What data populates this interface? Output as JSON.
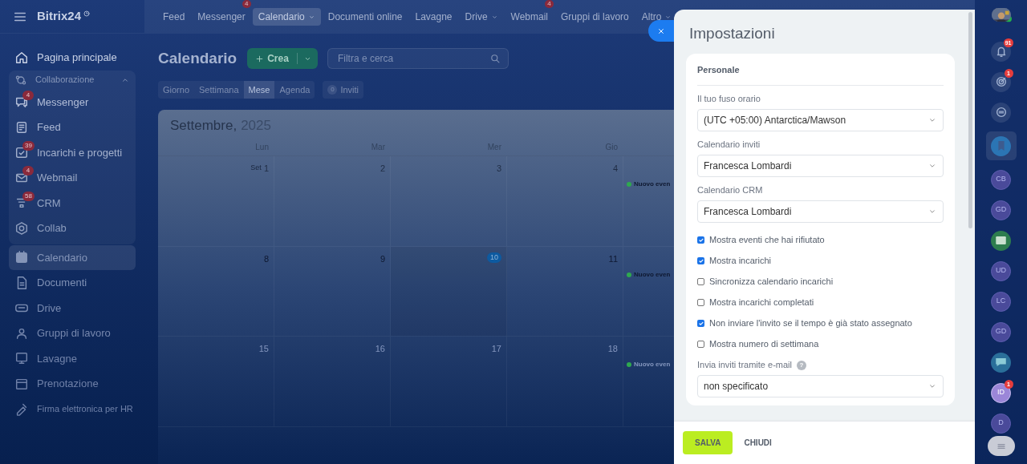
{
  "header": {
    "logo": "Bitrix24"
  },
  "top_nav": [
    {
      "label": "Feed",
      "selected": false,
      "dropdown": false
    },
    {
      "label": "Messenger",
      "selected": false,
      "dropdown": false,
      "badge": "4"
    },
    {
      "label": "Calendario",
      "selected": true,
      "dropdown": true
    },
    {
      "label": "Documenti online",
      "selected": false,
      "dropdown": false
    },
    {
      "label": "Lavagne",
      "selected": false,
      "dropdown": false
    },
    {
      "label": "Drive",
      "selected": false,
      "dropdown": true
    },
    {
      "label": "Webmail",
      "selected": false,
      "dropdown": false,
      "badge": "4"
    },
    {
      "label": "Gruppi di lavoro",
      "selected": false,
      "dropdown": false
    },
    {
      "label": "Altro",
      "selected": false,
      "dropdown": true
    }
  ],
  "sidebar": {
    "items": [
      {
        "kind": "home",
        "label": "Pagina principale",
        "selected": false
      },
      {
        "kind": "group",
        "label": "Collaborazione",
        "expanded": true,
        "children": [
          {
            "kind": "chat",
            "label": "Messenger",
            "selected": false,
            "badge": "4"
          },
          {
            "kind": "feed",
            "label": "Feed",
            "selected": false
          },
          {
            "kind": "tasks",
            "label": "Incarichi e progetti",
            "selected": false,
            "badge": "39"
          },
          {
            "kind": "mail",
            "label": "Webmail",
            "selected": false,
            "badge": "4"
          },
          {
            "kind": "crm",
            "label": "CRM",
            "selected": false,
            "badge": "58"
          },
          {
            "kind": "collab",
            "label": "Collab",
            "selected": false
          }
        ]
      },
      {
        "kind": "calendar",
        "label": "Calendario",
        "selected": true
      },
      {
        "kind": "doc",
        "label": "Documenti",
        "selected": false
      },
      {
        "kind": "drive",
        "label": "Drive",
        "selected": false
      },
      {
        "kind": "groups",
        "label": "Gruppi di lavoro",
        "selected": false
      },
      {
        "kind": "board",
        "label": "Lavagne",
        "selected": false
      },
      {
        "kind": "booking",
        "label": "Prenotazione",
        "selected": false
      },
      {
        "kind": "sign",
        "label": "Firma elettronica per HR",
        "selected": false
      }
    ]
  },
  "toolbar": {
    "title": "Calendario",
    "create_button": "Crea",
    "search": {
      "placeholder": "Filtra e cerca"
    },
    "views": [
      {
        "label": "Giorno",
        "selected": false
      },
      {
        "label": "Settimana",
        "selected": false
      },
      {
        "label": "Mese",
        "selected": true
      },
      {
        "label": "Agenda",
        "selected": false
      }
    ],
    "invites": {
      "count": "0",
      "label": "Inviti"
    }
  },
  "calendar": {
    "month": "Settembre,",
    "year": "2025",
    "weekdays": [
      "Lun",
      "Mar",
      "Mer",
      "Gio"
    ],
    "weeks": [
      {
        "days": [
          {
            "prefix": "Set",
            "label": "1",
            "today": false
          },
          {
            "label": "2",
            "today": false
          },
          {
            "label": "3",
            "today": false
          },
          {
            "label": "4",
            "today": false
          }
        ],
        "event": {
          "title": "Nuovo even",
          "color": "#2fa84f"
        }
      },
      {
        "days": [
          {
            "label": "8",
            "today": false
          },
          {
            "label": "9",
            "today": false
          },
          {
            "label": "10",
            "today": true
          },
          {
            "label": "11",
            "today": false
          }
        ],
        "event": {
          "title": "Nuovo even",
          "color": "#2fa84f"
        }
      },
      {
        "days": [
          {
            "label": "15",
            "today": false
          },
          {
            "label": "16",
            "today": false
          },
          {
            "label": "17",
            "today": false
          },
          {
            "label": "18",
            "today": false
          }
        ],
        "event": {
          "title": "Nuovo even",
          "color": "#2fa84f"
        }
      }
    ]
  },
  "settings": {
    "title": "Impostazioni",
    "section": "Personale",
    "items": [
      {
        "kind": "select",
        "label": "Il tuo fuso orario",
        "value": "(UTC +05:00) Antarctica/Mawson"
      },
      {
        "kind": "select",
        "label": "Calendario inviti",
        "value": "Francesca Lombardi"
      },
      {
        "kind": "select",
        "label": "Calendario CRM",
        "value": "Francesca Lombardi"
      },
      {
        "kind": "checkbox",
        "label": "Mostra eventi che hai rifiutato",
        "checked": true
      },
      {
        "kind": "checkbox",
        "label": "Mostra incarichi",
        "checked": true
      },
      {
        "kind": "checkbox",
        "label": "Sincronizza calendario incarichi",
        "checked": false
      },
      {
        "kind": "checkbox",
        "label": "Mostra incarichi completati",
        "checked": false
      },
      {
        "kind": "checkbox",
        "label": "Non inviare l'invito se il tempo è già stato assegnato",
        "checked": true
      },
      {
        "kind": "checkbox",
        "label": "Mostra numero di settimana",
        "checked": false
      },
      {
        "kind": "select",
        "label": "Invia inviti tramite e-mail",
        "value": "non specificato",
        "help": "?"
      }
    ],
    "buttons": [
      {
        "kind": "primary",
        "label": "SALVA"
      },
      {
        "kind": "link",
        "label": "CHIUDI"
      }
    ]
  },
  "right_rail": [
    {
      "kind": "bell",
      "badge": "91",
      "selected": false
    },
    {
      "kind": "target",
      "badge": "1",
      "selected": false
    },
    {
      "kind": "chat",
      "selected": false
    },
    {
      "kind": "bookmark",
      "selected": true
    },
    {
      "kind": "initials",
      "text": "CB",
      "selected": false,
      "highlight": false
    },
    {
      "kind": "initials",
      "text": "GD",
      "selected": false,
      "highlight": false
    },
    {
      "kind": "card",
      "selected": false
    },
    {
      "kind": "initials",
      "text": "UD",
      "selected": false,
      "highlight": false
    },
    {
      "kind": "initials",
      "text": "LC",
      "selected": false,
      "highlight": false
    },
    {
      "kind": "initials",
      "text": "GD",
      "selected": false,
      "highlight": false
    },
    {
      "kind": "message",
      "selected": false
    },
    {
      "kind": "initials",
      "text": "ID",
      "badge": "1",
      "selected": false,
      "highlight": true
    },
    {
      "kind": "initials",
      "text": "D",
      "selected": false,
      "highlight": false
    }
  ]
}
